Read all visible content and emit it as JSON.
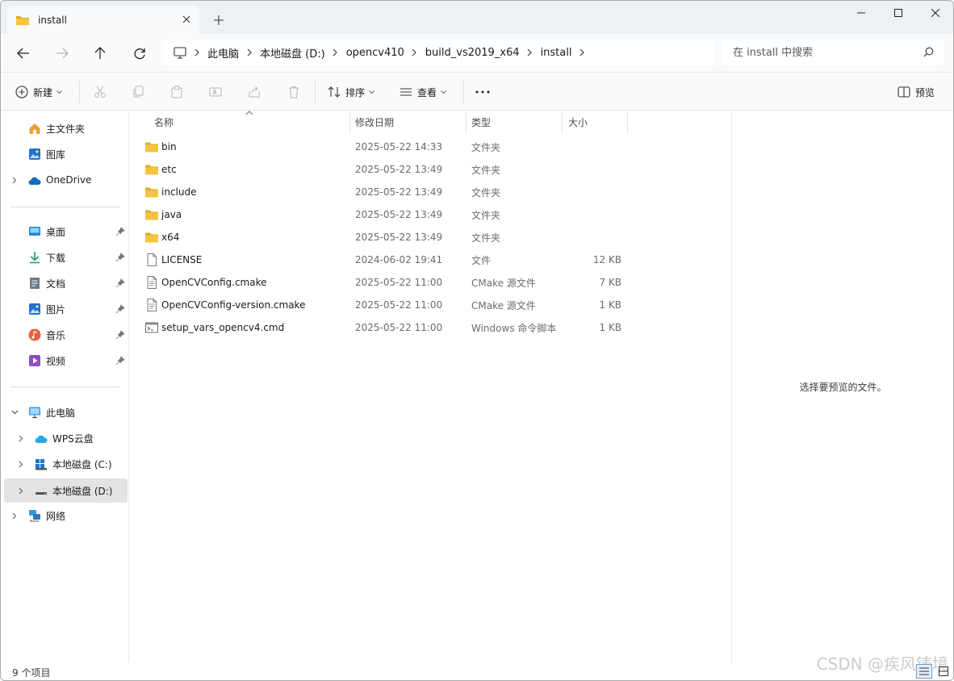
{
  "tab": {
    "title": "install"
  },
  "breadcrumb": [
    "此电脑",
    "本地磁盘 (D:)",
    "opencv410",
    "build_vs2019_x64",
    "install"
  ],
  "search": {
    "placeholder": "在 install 中搜索"
  },
  "commands": {
    "new": "新建",
    "sort": "排序",
    "view": "查看",
    "preview": "预览"
  },
  "sidebar": {
    "top": [
      {
        "label": "主文件夹",
        "icon": "home-icon"
      },
      {
        "label": "图库",
        "icon": "gallery-icon"
      },
      {
        "label": "OneDrive",
        "icon": "cloud-icon"
      }
    ],
    "quick": [
      {
        "label": "桌面",
        "icon": "desktop-icon"
      },
      {
        "label": "下载",
        "icon": "download-icon"
      },
      {
        "label": "文档",
        "icon": "document-icon"
      },
      {
        "label": "图片",
        "icon": "pictures-icon"
      },
      {
        "label": "音乐",
        "icon": "music-icon"
      },
      {
        "label": "视频",
        "icon": "video-icon"
      }
    ],
    "pc": [
      {
        "label": "此电脑",
        "icon": "computer-icon"
      },
      {
        "label": "WPS云盘",
        "icon": "wps-cloud-icon"
      },
      {
        "label": "本地磁盘 (C:)",
        "icon": "drive-c-icon"
      },
      {
        "label": "本地磁盘 (D:)",
        "icon": "drive-d-icon"
      },
      {
        "label": "网络",
        "icon": "network-icon"
      }
    ]
  },
  "columns": {
    "name": "名称",
    "date": "修改日期",
    "type": "类型",
    "size": "大小"
  },
  "files": [
    {
      "name": "bin",
      "date": "2025-05-22 14:33",
      "type": "文件夹",
      "size": "",
      "kind": "folder"
    },
    {
      "name": "etc",
      "date": "2025-05-22 13:49",
      "type": "文件夹",
      "size": "",
      "kind": "folder"
    },
    {
      "name": "include",
      "date": "2025-05-22 13:49",
      "type": "文件夹",
      "size": "",
      "kind": "folder"
    },
    {
      "name": "java",
      "date": "2025-05-22 13:49",
      "type": "文件夹",
      "size": "",
      "kind": "folder"
    },
    {
      "name": "x64",
      "date": "2025-05-22 13:49",
      "type": "文件夹",
      "size": "",
      "kind": "folder"
    },
    {
      "name": "LICENSE",
      "date": "2024-06-02 19:41",
      "type": "文件",
      "size": "12 KB",
      "kind": "file"
    },
    {
      "name": "OpenCVConfig.cmake",
      "date": "2025-05-22 11:00",
      "type": "CMake 源文件",
      "size": "7 KB",
      "kind": "text"
    },
    {
      "name": "OpenCVConfig-version.cmake",
      "date": "2025-05-22 11:00",
      "type": "CMake 源文件",
      "size": "1 KB",
      "kind": "text"
    },
    {
      "name": "setup_vars_opencv4.cmd",
      "date": "2025-05-22 11:00",
      "type": "Windows 命令脚本",
      "size": "1 KB",
      "kind": "script"
    }
  ],
  "preview": {
    "message": "选择要预览的文件。"
  },
  "status": {
    "count": "9 个项目"
  },
  "watermark": "CSDN @疾风铸境",
  "colors": {
    "folder": "#f4c542",
    "folder_dark": "#e3a821",
    "accent": "#0067c0",
    "selected": "#e3e3e3"
  }
}
